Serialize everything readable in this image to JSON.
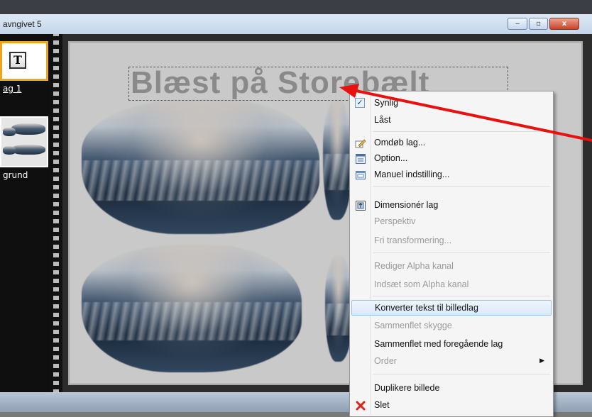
{
  "window": {
    "title": "avngivet 5",
    "buttons": {
      "minimize": "‒",
      "maximize": "▫",
      "close": "x"
    }
  },
  "layers": [
    {
      "label": "ag 1",
      "type": "text",
      "thumb_glyph": "T"
    },
    {
      "label": "grund",
      "type": "image"
    }
  ],
  "canvas": {
    "title_text": "Blæst på Storebælt"
  },
  "context_menu": {
    "items": [
      {
        "label": "Synlig",
        "checked": true,
        "enabled": true
      },
      {
        "label": "Låst",
        "checked": false,
        "enabled": true
      },
      {
        "label": "Omdøb lag...",
        "icon": "rename-icon",
        "enabled": true
      },
      {
        "label": "Option...",
        "icon": "option-icon",
        "enabled": true
      },
      {
        "label": "Manuel indstilling...",
        "icon": "manual-settings-icon",
        "enabled": true
      },
      {
        "label": "Dimensionér lag",
        "icon": "resize-icon",
        "enabled": true
      },
      {
        "label": "Perspektiv",
        "enabled": false
      },
      {
        "label": "Fri transformering...",
        "enabled": false
      },
      {
        "label": "Rediger Alpha kanal",
        "enabled": false
      },
      {
        "label": "Indsæt som Alpha kanal",
        "enabled": false
      },
      {
        "label": "Konverter tekst til billedlag",
        "enabled": true,
        "highlighted": true
      },
      {
        "label": "Sammenflet skygge",
        "enabled": false
      },
      {
        "label": "Sammenflet med foregående lag",
        "enabled": true
      },
      {
        "label": "Order",
        "enabled": false,
        "submenu": true
      },
      {
        "label": "Duplikere billede",
        "enabled": true
      },
      {
        "label": "Slet",
        "icon": "delete-icon",
        "enabled": true
      }
    ]
  },
  "colors": {
    "highlight_border": "#9cc0e6",
    "selected_layer_border": "#f2a51c",
    "annotation_arrow": "#e8110f",
    "delete_icon": "#d9261c"
  }
}
